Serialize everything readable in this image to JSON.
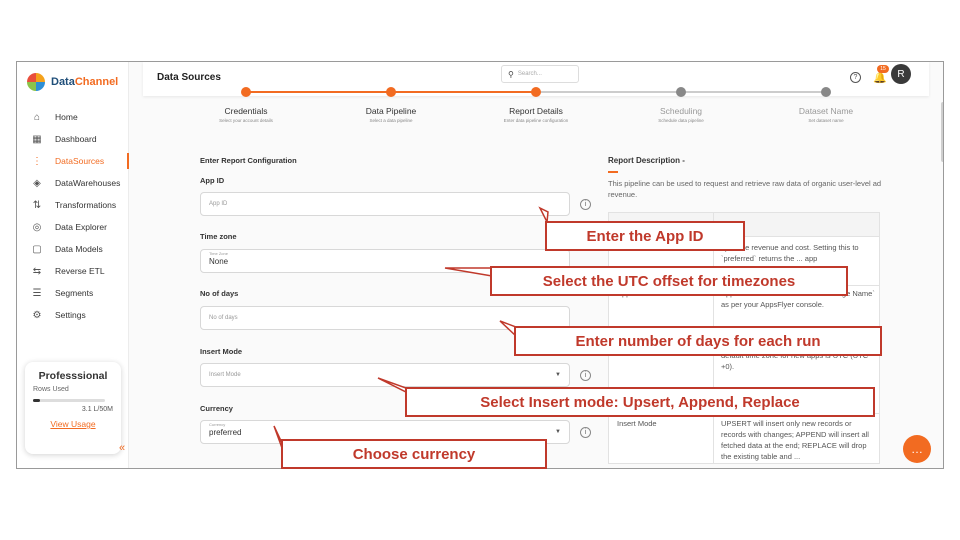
{
  "app": {
    "brand_a": "Data",
    "brand_b": "Channel"
  },
  "sidebar": {
    "items": [
      {
        "label": "Home",
        "icon": "home-icon",
        "active": false
      },
      {
        "label": "Dashboard",
        "icon": "dashboard-icon",
        "active": false
      },
      {
        "label": "DataSources",
        "icon": "datasources-icon",
        "active": true
      },
      {
        "label": "DataWarehouses",
        "icon": "datawarehouse-icon",
        "active": false
      },
      {
        "label": "Transformations",
        "icon": "transform-icon",
        "active": false
      },
      {
        "label": "Data Explorer",
        "icon": "explorer-icon",
        "active": false
      },
      {
        "label": "Data Models",
        "icon": "models-icon",
        "active": false
      },
      {
        "label": "Reverse ETL",
        "icon": "reverse-etl-icon",
        "active": false
      },
      {
        "label": "Segments",
        "icon": "segments-icon",
        "active": false
      },
      {
        "label": "Settings",
        "icon": "settings-icon",
        "active": false
      }
    ],
    "plan": {
      "title": "Professsional",
      "rows_label": "Rows Used",
      "usage": "3.1 L/50M",
      "usage_fraction": 0.1,
      "link": "View Usage"
    }
  },
  "header": {
    "title": "Data Sources",
    "search_placeholder": "Search...",
    "notification_count": "15",
    "avatar": "R"
  },
  "stepper": {
    "steps": [
      {
        "label": "Credentials",
        "sub": "Select your account details",
        "done": true
      },
      {
        "label": "Data Pipeline",
        "sub": "Select a data pipeline",
        "done": true
      },
      {
        "label": "Report Details",
        "sub": "Enter data pipeline configuration",
        "done": true
      },
      {
        "label": "Scheduling",
        "sub": "Schedule data pipeline",
        "done": false
      },
      {
        "label": "Dataset Name",
        "sub": "Set dataset name",
        "done": false
      }
    ]
  },
  "form": {
    "section_title": "Enter Report Configuration",
    "app_id": {
      "label": "App ID",
      "placeholder": "App ID"
    },
    "timezone": {
      "label": "Time zone",
      "float_label": "Time Zone",
      "value": "None"
    },
    "days": {
      "label": "No of days",
      "placeholder": "No of days"
    },
    "insert_mode": {
      "label": "Insert Mode",
      "placeholder": "Insert Mode"
    },
    "currency": {
      "label": "Currency",
      "float_label": "Currency",
      "value": "preferred"
    }
  },
  "description": {
    "title": "Report Description -",
    "text": "This pipeline can be used to request and retrieve raw data of organic user-level ad revenue.",
    "table": {
      "header_col2": "ption",
      "rows": [
        {
          "col2": "cy of the revenue and cost. Setting this to `preferred` returns the ... app"
        },
        {
          "col1": "App ID",
          "col2": "Apple `Bundle ID` or Android `Package Name` as per your AppsFlyer console."
        },
        {
          "col2": "default time zone for new apps is UTC (UTC +0)."
        },
        {
          "col1": "Insert Mode",
          "col2": "UPSERT will insert only new records or records with changes; APPEND will insert all fetched data at the end; REPLACE will drop the existing table and ..."
        }
      ]
    }
  },
  "annotations": {
    "app_id": "Enter the App ID",
    "timezone": "Select the UTC offset for timezones",
    "days": "Enter number of days for each run",
    "insert_mode": "Select Insert mode: Upsert, Append, Replace",
    "currency": "Choose currency"
  },
  "colors": {
    "accent": "#f26b21",
    "annotation": "#c0392b"
  }
}
